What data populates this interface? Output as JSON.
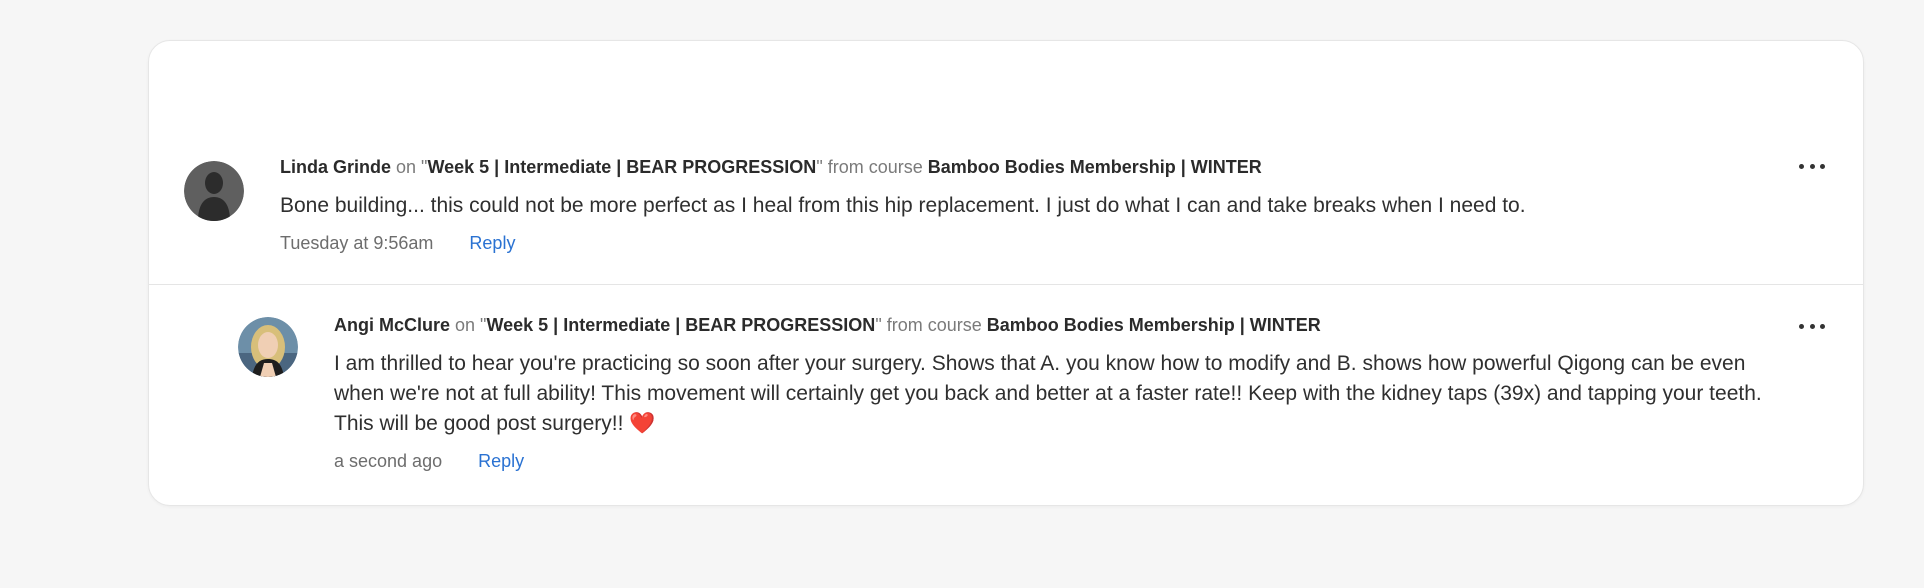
{
  "comments": [
    {
      "author": "Linda Grinde",
      "on_text": "on \"",
      "lesson": "Week 5 | Intermediate | BEAR PROGRESSION",
      "from_text": "\" from course ",
      "course": "Bamboo Bodies Membership | WINTER",
      "text": "Bone building... this could not be more perfect as I heal from this hip replacement. I just do what I can and take breaks when I need to.",
      "time": "Tuesday at 9:56am",
      "reply_label": "Reply",
      "avatar_icon": "default-person-icon"
    },
    {
      "author": "Angi McClure",
      "on_text": "on \"",
      "lesson": "Week 5 | Intermediate | BEAR PROGRESSION",
      "from_text": "\" from course ",
      "course": "Bamboo Bodies Membership | WINTER",
      "text": "I am thrilled to hear you're practicing so soon after your surgery. Shows that A. you know how to modify and B. shows how powerful Qigong can be even when we're not at full ability! This movement will certainly get you back and better at a faster rate!! Keep with the kidney taps (39x) and tapping your teeth. This will be good post surgery!!",
      "heart": "❤️",
      "time": "a second ago",
      "reply_label": "Reply",
      "avatar_icon": "user-photo"
    }
  ],
  "colors": {
    "link": "#2a72d2",
    "background": "#f6f6f6",
    "card": "#ffffff"
  }
}
